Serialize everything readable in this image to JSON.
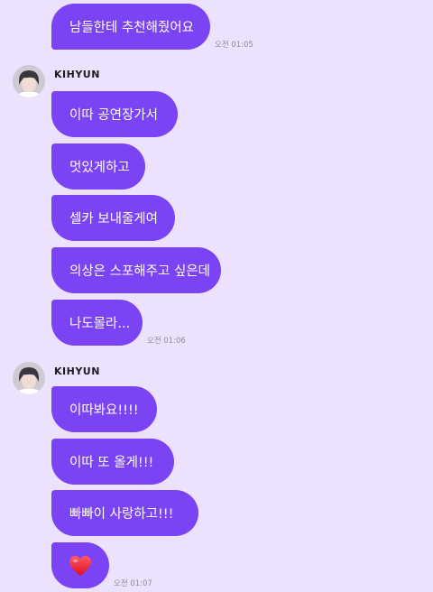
{
  "messages_top": {
    "bubble_1": "남들한테 추천해줬어요",
    "time_1": "오전 01:05"
  },
  "group_1": {
    "sender_name": "KIHYUN",
    "bubbles": [
      "이따 공연장가서",
      "멋있게하고",
      "셀카 보내줄게여",
      "의상은 스포해주고 싶은데",
      "나도몰라..."
    ],
    "time": "오전 01:06"
  },
  "group_2": {
    "sender_name": "KIHYUN",
    "bubbles": [
      "이따봐요!!!!",
      "이따 또 올게!!!",
      "빠빠이 사랑하고!!!"
    ],
    "heart_icon": "heart-emoji",
    "time": "오전 01:07"
  },
  "colors": {
    "background": "#ede2fd",
    "bubble": "#7a43f4",
    "bubble_text": "#ffffff",
    "heart": "#e8192c"
  }
}
